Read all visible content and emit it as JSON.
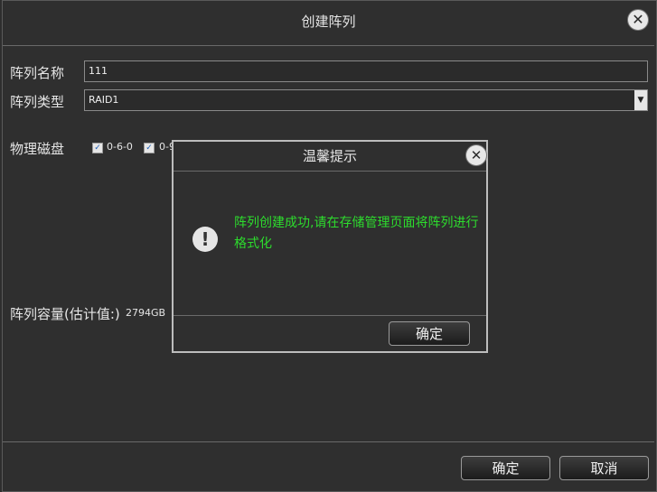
{
  "dialog": {
    "title": "创建阵列",
    "close_glyph": "✕"
  },
  "form": {
    "array_name_label": "阵列名称",
    "array_name_value": "111",
    "array_type_label": "阵列类型",
    "array_type_value": "RAID1",
    "physical_disk_label": "物理磁盘",
    "disks": [
      {
        "label": "0-6-0",
        "checked": true
      },
      {
        "label": "0-9",
        "checked": true
      }
    ],
    "capacity_label": "阵列容量(估计值:)",
    "capacity_value": "2794GB"
  },
  "footer": {
    "ok_label": "确定",
    "cancel_label": "取消"
  },
  "modal": {
    "title": "温馨提示",
    "message": "阵列创建成功,请在存储管理页面将阵列进行格式化",
    "ok_label": "确定",
    "message_color": "#2ddc2d"
  },
  "icons": {
    "close": "close-icon",
    "warning": "warning-icon",
    "dropdown": "chevron-down-icon",
    "checkbox": "check-icon"
  }
}
